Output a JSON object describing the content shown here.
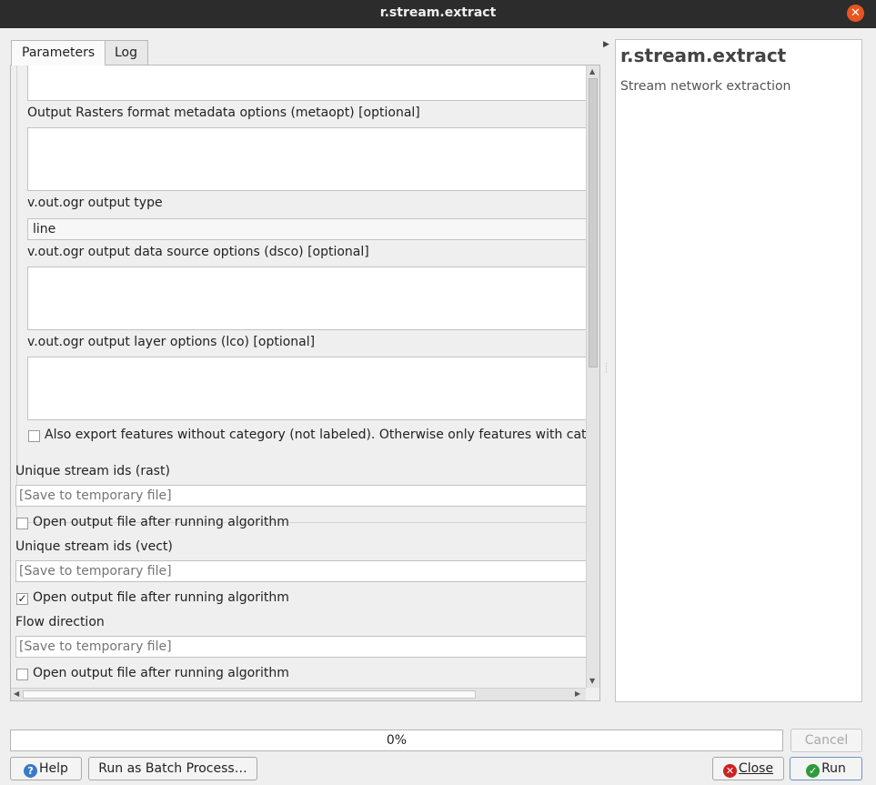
{
  "window": {
    "title": "r.stream.extract"
  },
  "tabs": [
    {
      "label": "Parameters"
    },
    {
      "label": "Log"
    }
  ],
  "params": {
    "metaopt_label": "Output Rasters format metadata options (metaopt) [optional]",
    "out_type_label": "v.out.ogr output type",
    "out_type_value": "line",
    "dsco_label": "v.out.ogr output data source options (dsco) [optional]",
    "lco_label": "v.out.ogr output layer options (lco) [optional]",
    "export_nocat_label": "Also export features without category (not labeled). Otherwise only features with category are exported",
    "export_nocat_checked": false,
    "outputs": [
      {
        "label": "Unique stream ids (rast)",
        "placeholder": "[Save to temporary file]",
        "open_label": "Open output file after running algorithm",
        "open_checked": false
      },
      {
        "label": "Unique stream ids (vect)",
        "placeholder": "[Save to temporary file]",
        "open_label": "Open output file after running algorithm",
        "open_checked": true
      },
      {
        "label": "Flow direction",
        "placeholder": "[Save to temporary file]",
        "open_label": "Open output file after running algorithm",
        "open_checked": false
      }
    ]
  },
  "help": {
    "title": "r.stream.extract",
    "description": "Stream network extraction"
  },
  "progress": {
    "value": 0,
    "text": "0%"
  },
  "buttons": {
    "cancel": "Cancel",
    "help": "Help",
    "batch": "Run as Batch Process…",
    "close": "Close",
    "run": "Run"
  },
  "colors": {
    "titlebar": "#2c2c2c",
    "close_accent": "#e95420",
    "help_icon": "#3a78c9",
    "close_icon": "#cc2222",
    "run_icon": "#2f9a3c"
  },
  "icons": {
    "window_close": "close-x-icon",
    "help": "help-icon",
    "close": "close-icon",
    "run": "run-check-icon"
  }
}
